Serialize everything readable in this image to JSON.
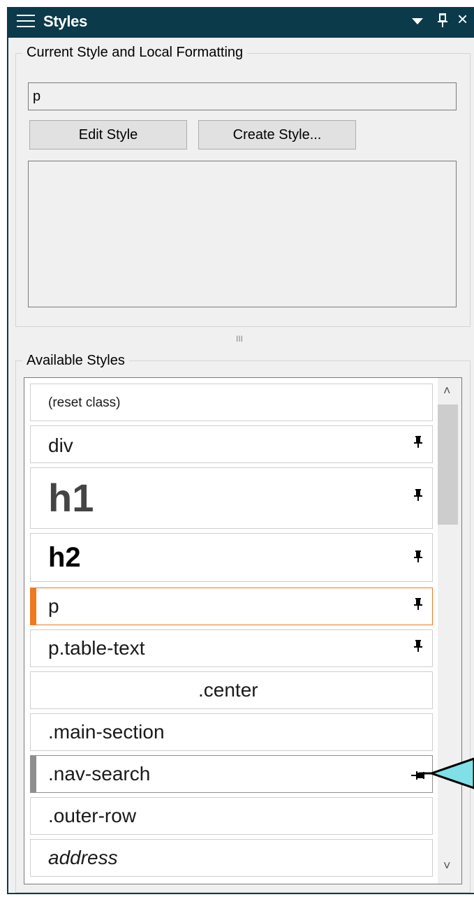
{
  "window": {
    "title": "Styles",
    "icons": {
      "menu": "hamburger-icon",
      "dropdown": "dropdown-arrow-icon",
      "pin": "pin-icon",
      "close": "close-icon"
    },
    "pin_glyph": "Ն",
    "close_glyph": "×"
  },
  "current_style": {
    "group_label": "Current Style and Local Formatting",
    "value": "p",
    "edit_button": "Edit Style",
    "create_button": "Create Style..."
  },
  "splitter": {
    "glyph": "III"
  },
  "available_styles": {
    "group_label": "Available Styles",
    "items": [
      {
        "label": "(reset class)",
        "pinned": false
      },
      {
        "label": "div",
        "pinned": true
      },
      {
        "label": "h1",
        "pinned": true
      },
      {
        "label": "h2",
        "pinned": true
      },
      {
        "label": "p",
        "pinned": true,
        "selected": true
      },
      {
        "label": "p.table-text",
        "pinned": true
      },
      {
        "label": ".center",
        "pinned": false
      },
      {
        "label": ".main-section",
        "pinned": false
      },
      {
        "label": ".nav-search",
        "pinned": true,
        "highlighted": true
      },
      {
        "label": ".outer-row",
        "pinned": false
      },
      {
        "label": "address",
        "pinned": false
      }
    ],
    "pin_glyph": "📌",
    "scroll_up": "˄",
    "scroll_down": "˅"
  },
  "colors": {
    "titlebar": "#0b3a4a",
    "selected_accent": "#f07820",
    "callout": "#7fe0e8"
  }
}
